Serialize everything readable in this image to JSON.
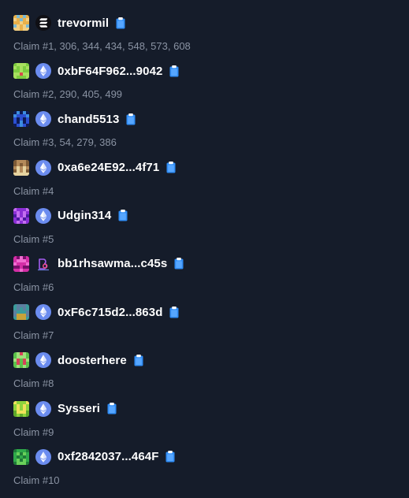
{
  "colors": {
    "background": "#151c2a",
    "name_text": "#ffffff",
    "claim_text": "#8a93a3",
    "clipboard_accent": "#2f8cf5",
    "ethereum_badge": "#6b8cef",
    "solana_badge": "#0f0f14"
  },
  "entries": [
    {
      "name": "trevormil",
      "chain_icon": "solana-icon",
      "avatar_colors": [
        "#e9b04a",
        "#7bbad5",
        "#f3cf82"
      ],
      "claim_text": "Claim #1, 306, 344, 434, 548, 573, 608"
    },
    {
      "name": "0xbF64F962...9042",
      "chain_icon": "ethereum-icon",
      "avatar_colors": [
        "#7ccc3f",
        "#d84b4b",
        "#a8e05f"
      ],
      "claim_text": "Claim #2, 290, 405, 499"
    },
    {
      "name": "chand5513",
      "chain_icon": "ethereum-icon",
      "avatar_colors": [
        "#2b4fd1",
        "#0e1a55",
        "#3c8de0"
      ],
      "claim_text": "Claim #3, 54, 279, 386"
    },
    {
      "name": "0xa6e24E92...4f71",
      "chain_icon": "ethereum-icon",
      "avatar_colors": [
        "#b48a5a",
        "#e6d3a0",
        "#7d5a36"
      ],
      "claim_text": "Claim #4"
    },
    {
      "name": "Udgin314",
      "chain_icon": "ethereum-icon",
      "avatar_colors": [
        "#8b2fd6",
        "#4a1aa0",
        "#c46ef0"
      ],
      "claim_text": "Claim #5"
    },
    {
      "name": "bb1rhsawma...c45s",
      "chain_icon": "bitbadges-icon",
      "avatar_colors": [
        "#d42ea6",
        "#7a0f6a",
        "#f06cd0"
      ],
      "claim_text": "Claim #6"
    },
    {
      "name": "0xF6c715d2...863d",
      "chain_icon": "ethereum-icon",
      "avatar_colors": [
        "#3a9b9b",
        "#c7a23a",
        "#5d7fa0"
      ],
      "claim_text": "Claim #7"
    },
    {
      "name": "doosterhere",
      "chain_icon": "ethereum-icon",
      "avatar_colors": [
        "#5bc24a",
        "#d6435a",
        "#9fe07a"
      ],
      "claim_text": "Claim #8"
    },
    {
      "name": "Sysseri",
      "chain_icon": "ethereum-icon",
      "avatar_colors": [
        "#8dd43c",
        "#f0e15a",
        "#5ea82a"
      ],
      "claim_text": "Claim #9"
    },
    {
      "name": "0xf2842037...464F",
      "chain_icon": "ethereum-icon",
      "avatar_colors": [
        "#2faa4a",
        "#6ad05a",
        "#1f7a38"
      ],
      "claim_text": "Claim #10"
    }
  ]
}
